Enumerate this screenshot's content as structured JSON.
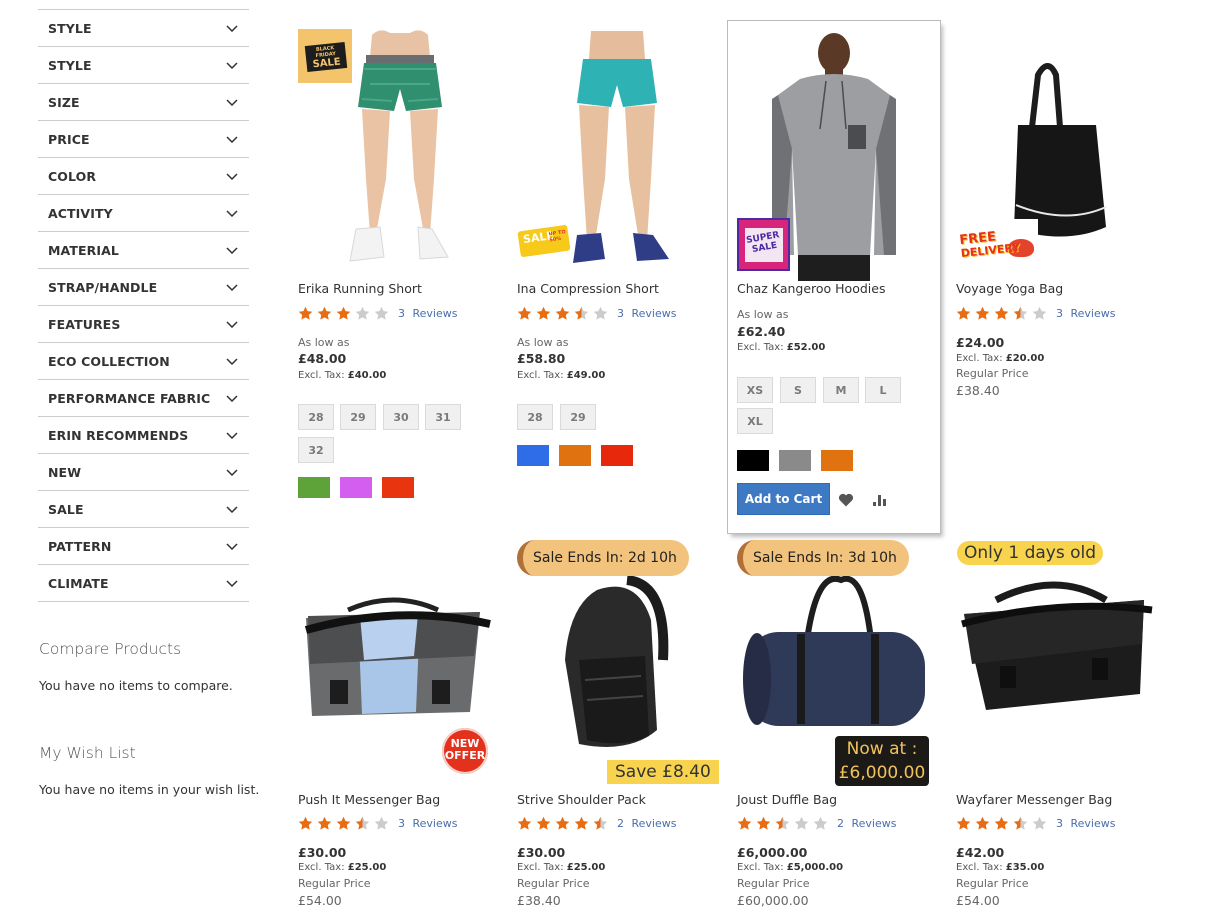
{
  "sidebar": {
    "filters": [
      "STYLE",
      "STYLE",
      "SIZE",
      "PRICE",
      "COLOR",
      "ACTIVITY",
      "MATERIAL",
      "STRAP/HANDLE",
      "FEATURES",
      "ECO COLLECTION",
      "PERFORMANCE FABRIC",
      "ERIN RECOMMENDS",
      "NEW",
      "SALE",
      "PATTERN",
      "CLIMATE"
    ],
    "compare": {
      "title": "Compare Products",
      "text": "You have no items to compare."
    },
    "wishlist": {
      "title": "My Wish List",
      "text": "You have no items in your wish list."
    }
  },
  "colors": {
    "accent": "#3d7ac3",
    "star": "#e66d13",
    "star_empty": "#cccccc",
    "link": "#4a6dac"
  },
  "products": [
    {
      "name": "Erika Running Short",
      "rating": 3,
      "reviews": "3  Reviews",
      "as_low_as": "As low as",
      "price": "£48.00",
      "excl_label": "Excl. Tax:",
      "excl_value": "£40.00",
      "sizes": [
        "28",
        "29",
        "30",
        "31",
        "32"
      ],
      "colors": [
        "#5ea339",
        "#d35ef0",
        "#e8340f"
      ],
      "badge_text": [
        "BLACK FRIDAY",
        "SALE"
      ]
    },
    {
      "name": "Ina Compression Short",
      "rating": 3.5,
      "reviews": "3  Reviews",
      "as_low_as": "As low as",
      "price": "£58.80",
      "excl_label": "Excl. Tax:",
      "excl_value": "£49.00",
      "sizes": [
        "28",
        "29"
      ],
      "colors": [
        "#2f6de8",
        "#e0730f",
        "#e8280c"
      ],
      "badge_text": [
        "SALE",
        "UP TO 50%"
      ]
    },
    {
      "name": "Chaz Kangeroo Hoodies",
      "as_low_as": "As low as",
      "price": "£62.40",
      "excl_label": "Excl. Tax:",
      "excl_value": "£52.00",
      "sizes": [
        "XS",
        "S",
        "M",
        "L",
        "XL"
      ],
      "colors": [
        "#000000",
        "#8a8a8a",
        "#e0730f"
      ],
      "add_to_cart": "Add to Cart",
      "badge_text": [
        "SUPER",
        "SALE"
      ]
    },
    {
      "name": "Voyage Yoga Bag",
      "rating": 3.5,
      "reviews": "3  Reviews",
      "price": "£24.00",
      "excl_label": "Excl. Tax:",
      "excl_value": "£20.00",
      "regular_label": "Regular Price",
      "regular_price": "£38.40",
      "badge_text": [
        "FREE",
        "DELIVERY"
      ]
    },
    {
      "name": "Push It Messenger Bag",
      "rating": 3.5,
      "reviews": "3  Reviews",
      "price": "£30.00",
      "excl_label": "Excl. Tax:",
      "excl_value": "£25.00",
      "regular_label": "Regular Price",
      "regular_price": "£54.00",
      "badge_text": [
        "NEW",
        "OFFER"
      ]
    },
    {
      "name": "Strive Shoulder Pack",
      "rating": 4.5,
      "reviews": "2  Reviews",
      "price": "£30.00",
      "excl_label": "Excl. Tax:",
      "excl_value": "£25.00",
      "regular_label": "Regular Price",
      "regular_price": "£38.40",
      "sale_ends": "Sale Ends In: 2d 10h",
      "save_tag": "Save £8.40"
    },
    {
      "name": "Joust Duffle Bag",
      "rating": 2.5,
      "reviews": "2  Reviews",
      "price": "£6,000.00",
      "excl_label": "Excl. Tax:",
      "excl_value": "£5,000.00",
      "regular_label": "Regular Price",
      "regular_price": "£60,000.00",
      "sale_ends": "Sale Ends In: 3d 10h",
      "now_at": [
        "Now at :",
        "£6,000.00"
      ]
    },
    {
      "name": "Wayfarer Messenger Bag",
      "rating": 3.5,
      "reviews": "3  Reviews",
      "price": "£42.00",
      "excl_label": "Excl. Tax:",
      "excl_value": "£35.00",
      "regular_label": "Regular Price",
      "regular_price": "£54.00",
      "days_old": "Only 1 days old"
    }
  ]
}
